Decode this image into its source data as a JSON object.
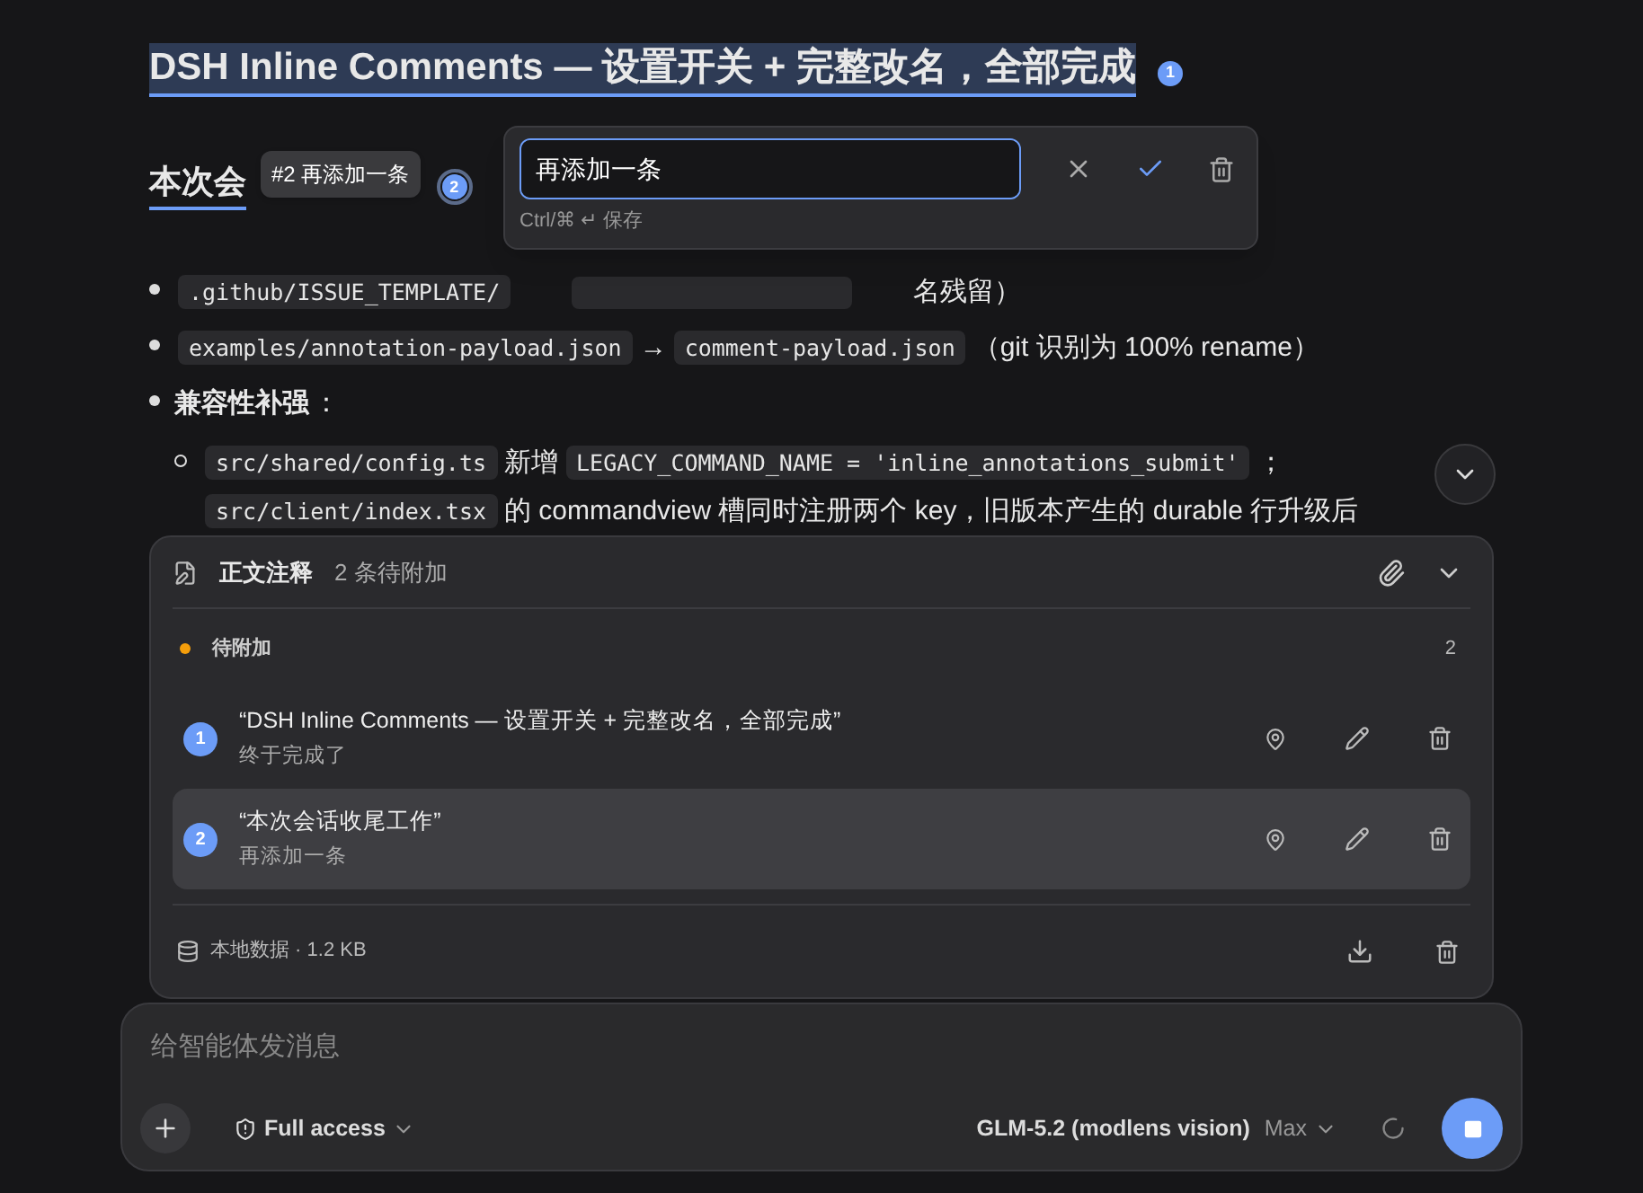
{
  "heading": {
    "text": "DSH Inline Comments — 设置开关 + 完整改名，全部完成",
    "badge": "1",
    "highlighted": true
  },
  "heading_2": {
    "text": "本次会",
    "badge": "2",
    "tooltip": "#2 再添加一条"
  },
  "editor": {
    "value": "再添加一条",
    "hint": "Ctrl/⌘ ↵ 保存"
  },
  "bullets": [
    {
      "parts": [
        {
          "kind": "code",
          "text": ".github/ISSUE_TEMPLATE/"
        },
        {
          "kind": "stub"
        },
        {
          "kind": "text",
          "text": "名残留）"
        }
      ]
    },
    {
      "parts": [
        {
          "kind": "code",
          "text": "examples/annotation-payload.json"
        },
        {
          "kind": "text",
          "text": "→"
        },
        {
          "kind": "code",
          "text": "comment-payload.json"
        },
        {
          "kind": "text",
          "text": "（git 识别为 100% rename）"
        }
      ]
    },
    {
      "parts": [
        {
          "kind": "bold",
          "text": "兼容性补强"
        },
        {
          "kind": "text",
          "text": "："
        }
      ],
      "children": [
        {
          "parts": [
            {
              "kind": "code",
              "text": "src/shared/config.ts"
            },
            {
              "kind": "text",
              "text": "新增"
            },
            {
              "kind": "code",
              "text": "LEGACY_COMMAND_NAME = 'inline_annotations_submit'"
            },
            {
              "kind": "text",
              "text": "；"
            },
            {
              "kind": "code",
              "text": "src/client/index.tsx"
            },
            {
              "kind": "text",
              "text": "的 commandview 槽同时注册两个 key，旧版本产生的 durable 行升级后"
            }
          ]
        }
      ]
    }
  ],
  "panel": {
    "title": "正文注释",
    "count": "2 条待附加",
    "expanded": true,
    "section": {
      "label": "待附加",
      "count": "2",
      "color": "#f59e0b"
    },
    "items": [
      {
        "badge": "1",
        "quote": "“DSH Inline Comments — 设置开关 + 完整改名，全部完成”",
        "note": "终于完成了",
        "selected": false
      },
      {
        "badge": "2",
        "quote": "“本次会话收尾工作”",
        "note": "再添加一条",
        "selected": true
      }
    ],
    "footer": "本地数据 · 1.2 KB"
  },
  "composer": {
    "placeholder": "给智能体发消息",
    "access": "Full access",
    "model": "GLM-5.2 (modlens vision)",
    "effort": "Max",
    "running": true
  }
}
